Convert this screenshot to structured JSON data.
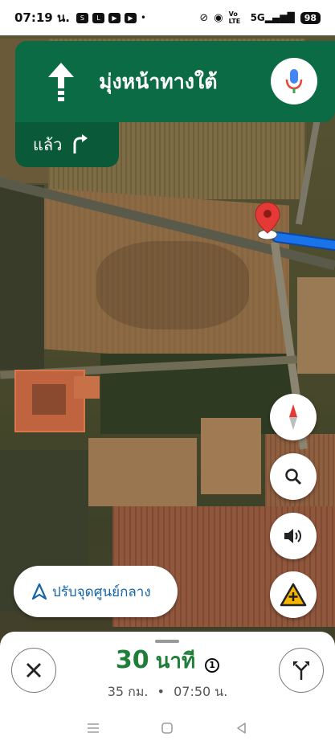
{
  "status_bar": {
    "time": "07:19 น.",
    "network": "Vo LTE",
    "signal": "5G",
    "battery": "98",
    "icons": [
      "shopee-icon",
      "line-icon",
      "youtube-icon",
      "youtube-icon",
      "dot"
    ]
  },
  "navigation": {
    "instruction": "มุ่งหน้าทางใต้",
    "then_label": "แล้ว",
    "banner_color": "#0b6b45"
  },
  "map_buttons": {
    "recenter_label": "ปรับจุดศูนย์กลาง"
  },
  "trip": {
    "duration_value": "30",
    "duration_unit": "นาที",
    "distance": "35 กม.",
    "separator": "•",
    "arrival": "07:50 น.",
    "accent_color": "#1e7e3a"
  }
}
